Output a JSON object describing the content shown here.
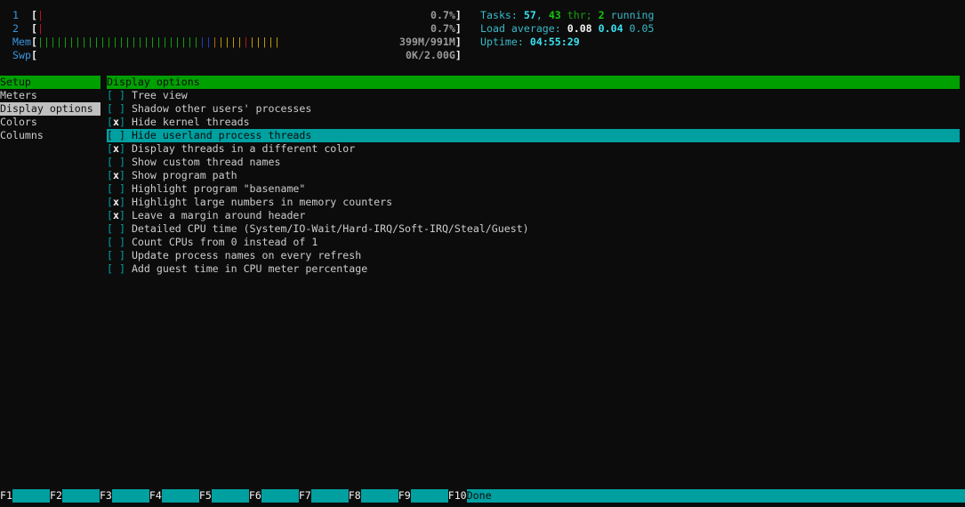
{
  "header": {
    "cpu": [
      {
        "label": "1",
        "value": "0.7%"
      },
      {
        "label": "2",
        "value": "0.7%"
      }
    ],
    "mem": {
      "label": "Mem",
      "value": "399M/991M",
      "used_fraction": 0.4
    },
    "swp": {
      "label": "Swp",
      "value": "0K/2.00G"
    },
    "tasks": {
      "label": "Tasks:",
      "count": "57",
      "thr": "43",
      "thr_label": "thr;",
      "running": "2",
      "running_label": "running"
    },
    "load": {
      "label": "Load average:",
      "l1": "0.08",
      "l5": "0.04",
      "l15": "0.05"
    },
    "uptime": {
      "label": "Uptime:",
      "value": "04:55:29"
    }
  },
  "sidebar": {
    "title": "Setup",
    "items": [
      {
        "label": "Meters"
      },
      {
        "label": "Display options"
      },
      {
        "label": "Colors"
      },
      {
        "label": "Columns"
      }
    ]
  },
  "panel": {
    "title": "Display options",
    "options": [
      {
        "label": "Tree view",
        "checked": false
      },
      {
        "label": "Shadow other users' processes",
        "checked": false
      },
      {
        "label": "Hide kernel threads",
        "checked": true
      },
      {
        "label": "Hide userland process threads",
        "checked": false
      },
      {
        "label": "Display threads in a different color",
        "checked": true
      },
      {
        "label": "Show custom thread names",
        "checked": false
      },
      {
        "label": "Show program path",
        "checked": true
      },
      {
        "label": "Highlight program \"basename\"",
        "checked": false
      },
      {
        "label": "Highlight large numbers in memory counters",
        "checked": true
      },
      {
        "label": "Leave a margin around header",
        "checked": true
      },
      {
        "label": "Detailed CPU time (System/IO-Wait/Hard-IRQ/Soft-IRQ/Steal/Guest)",
        "checked": false
      },
      {
        "label": "Count CPUs from 0 instead of 1",
        "checked": false
      },
      {
        "label": "Update process names on every refresh",
        "checked": false
      },
      {
        "label": "Add guest time in CPU meter percentage",
        "checked": false
      }
    ]
  },
  "fkeys": [
    {
      "key": "F1",
      "label": ""
    },
    {
      "key": "F2",
      "label": ""
    },
    {
      "key": "F3",
      "label": ""
    },
    {
      "key": "F4",
      "label": ""
    },
    {
      "key": "F5",
      "label": ""
    },
    {
      "key": "F6",
      "label": ""
    },
    {
      "key": "F7",
      "label": ""
    },
    {
      "key": "F8",
      "label": ""
    },
    {
      "key": "F9",
      "label": ""
    },
    {
      "key": "F10",
      "label": "Done"
    }
  ],
  "colors": {
    "header_bg": "#00a000",
    "highlight_bg": "#00a0a0",
    "selected_bg": "#c0c0c0"
  }
}
